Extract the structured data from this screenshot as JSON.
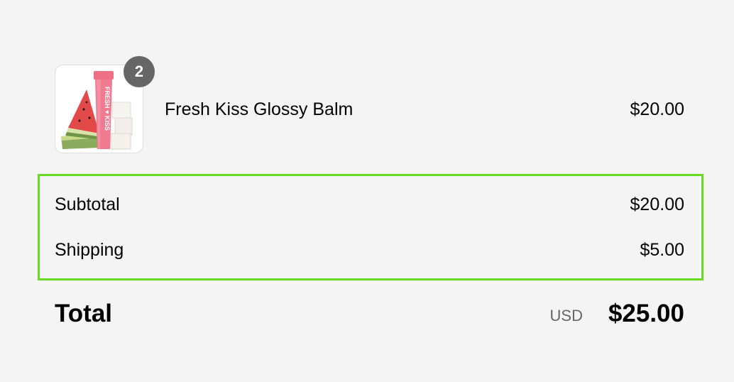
{
  "line_item": {
    "image_alt": "Fresh Kiss Glossy Balm product image",
    "image_tube_text": "FRESH ♥ KISS",
    "quantity": "2",
    "name": "Fresh Kiss Glossy Balm",
    "price": "$20.00"
  },
  "summary": {
    "subtotal_label": "Subtotal",
    "subtotal_value": "$20.00",
    "shipping_label": "Shipping",
    "shipping_value": "$5.00"
  },
  "total": {
    "label": "Total",
    "currency": "USD",
    "amount": "$25.00"
  },
  "colors": {
    "background": "#f4f4f4",
    "highlight_border": "#66dd22",
    "badge": "#666666",
    "muted_text": "#666666"
  }
}
